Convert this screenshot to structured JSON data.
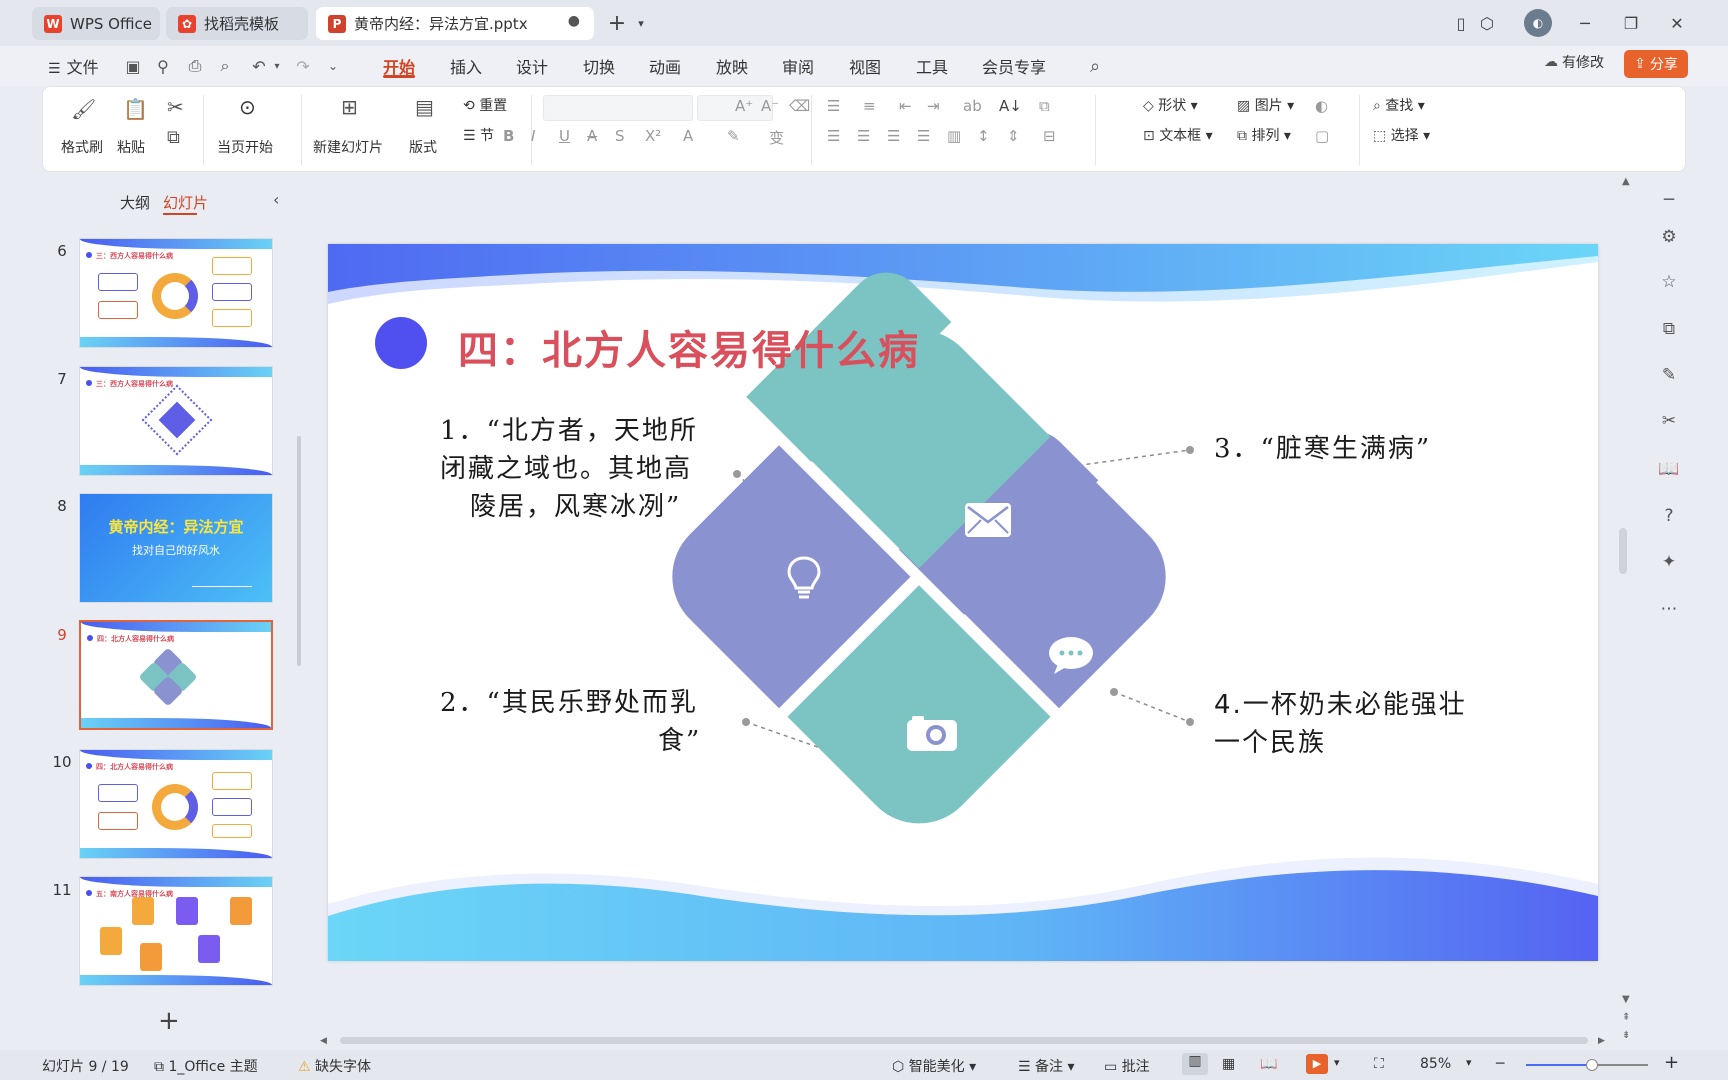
{
  "tabs": [
    {
      "label": "WPS Office",
      "icon": "wps-logo-icon",
      "color": "#e8412c"
    },
    {
      "label": "找稻壳模板",
      "icon": "docer-icon",
      "color": "#e8412c"
    },
    {
      "label": "黄帝内经：异法方宜.pptx",
      "icon": "ppt-icon",
      "color": "#d0422e"
    }
  ],
  "menu": [
    "文件",
    "开始",
    "插入",
    "设计",
    "切换",
    "动画",
    "放映",
    "审阅",
    "视图",
    "工具",
    "会员专享"
  ],
  "menu_active": "开始",
  "toolbar_right": {
    "modify": "有修改",
    "share": "分享"
  },
  "ribbon": {
    "format_painter": "格式刷",
    "paste": "粘贴",
    "from_current": "当页开始",
    "new_slide": "新建幻灯片",
    "layout": "版式",
    "reset": "重置",
    "section": "节",
    "shape": "形状",
    "picture": "图片",
    "find": "查找",
    "textbox": "文本框",
    "arrange": "排列",
    "select": "选择"
  },
  "left_panel": {
    "tabs": [
      "大纲",
      "幻灯片"
    ],
    "active_tab": "幻灯片",
    "thumbs": [
      {
        "num": "6",
        "title": "三：西方人容易得什么病"
      },
      {
        "num": "7",
        "title": "三：西方人容易得什么病"
      },
      {
        "num": "8",
        "title": "黄帝内经：异法方宜",
        "subtitle": "找对自己的好风水"
      },
      {
        "num": "9",
        "title": "四：北方人容易得什么病"
      },
      {
        "num": "10",
        "title": "四：北方人容易得什么病"
      },
      {
        "num": "11",
        "title": "五：南方人容易得什么病"
      }
    ],
    "selected": "9",
    "add_label": "+"
  },
  "slide": {
    "title": "四：北方人容易得什么病",
    "items": [
      {
        "line1": "1．“北方者，天地所",
        "line2": "闭藏之域也。其地高",
        "line3": "陵居，风寒冰冽”"
      },
      {
        "line1": "2．“其民乐野处而乳",
        "line2": "食”"
      },
      {
        "line1": "3．“脏寒生满病”"
      },
      {
        "line1": "4.一杯奶未必能强壮",
        "line2": "一个民族"
      }
    ],
    "colors": {
      "purple": "#8a93d0",
      "teal": "#7cc3c3",
      "title": "#d9505c",
      "dot": "#5050f0"
    }
  },
  "status": {
    "slide_count": "幻灯片 9 / 19",
    "theme": "1_Office 主题",
    "missing_font": "缺失字体",
    "beautify": "智能美化",
    "notes": "备注",
    "comments": "批注",
    "zoom": "85%"
  }
}
